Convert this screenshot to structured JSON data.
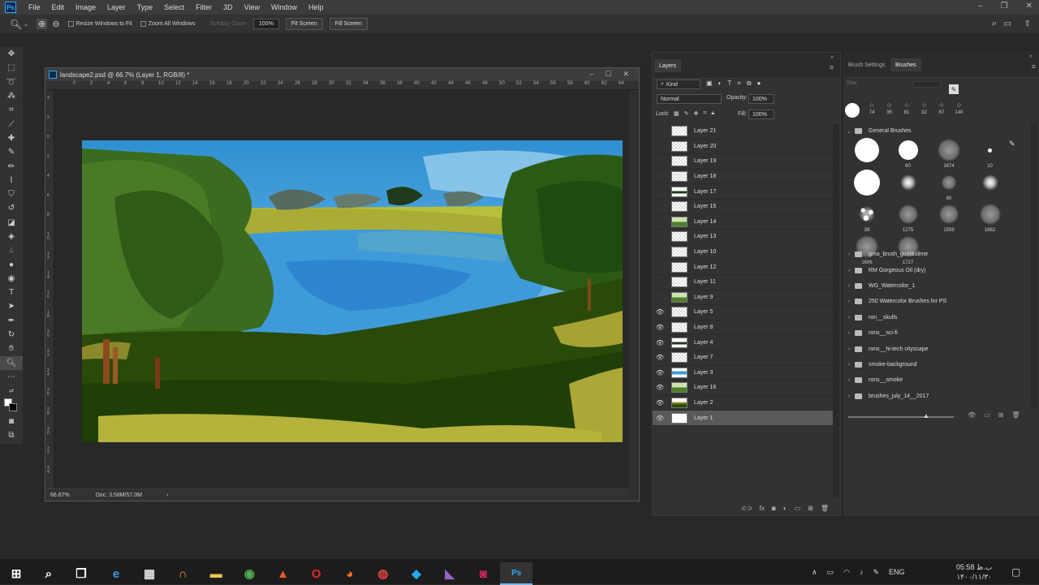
{
  "app": {
    "logo": "Ps",
    "menu": [
      "File",
      "Edit",
      "Image",
      "Layer",
      "Type",
      "Select",
      "Filter",
      "3D",
      "View",
      "Window",
      "Help"
    ]
  },
  "options": {
    "resize_windows": "Resize Windows to Fit",
    "zoom_all": "Zoom All Windows",
    "scrubby": "Scrubby Zoom",
    "zoom_value": "100%",
    "fit_screen": "Fit Screen",
    "fill_screen": "Fill Screen"
  },
  "document": {
    "title": "landscape2.psd @ 66.7% (Layer 1, RGB/8) *",
    "zoom": "66.67%",
    "doc_info": "Doc: 3.58M/57.0M",
    "hruler": [
      "0",
      "2",
      "4",
      "6",
      "8",
      "10",
      "12",
      "14",
      "16",
      "18",
      "20",
      "22",
      "24",
      "26",
      "28",
      "30",
      "32",
      "34",
      "36",
      "38",
      "40",
      "42",
      "44",
      "46",
      "48",
      "50",
      "52",
      "54",
      "56",
      "58",
      "60",
      "62",
      "64"
    ],
    "vruler": [
      "4",
      "2",
      "0",
      "2",
      "4",
      "6",
      "8",
      "1\n0",
      "1\n2",
      "1\n4",
      "1\n6",
      "1\n8",
      "2\n0",
      "2\n2",
      "2\n4",
      "2\n6",
      "2\n8",
      "3\n0",
      "3\n2",
      "3\n4"
    ]
  },
  "layers": {
    "tab": "Layers",
    "kind": "Kind",
    "blend": "Normal",
    "opacity_label": "Opacity:",
    "opacity": "100%",
    "lock_label": "Lock:",
    "fill_label": "Fill:",
    "fill": "100%",
    "items": [
      {
        "name": "Layer 21",
        "visible": false,
        "thumb": "empty"
      },
      {
        "name": "Layer 20",
        "visible": false,
        "thumb": "empty"
      },
      {
        "name": "Layer 19",
        "visible": false,
        "thumb": "empty"
      },
      {
        "name": "Layer 18",
        "visible": false,
        "thumb": "empty"
      },
      {
        "name": "Layer 17",
        "visible": false,
        "thumb": "dark"
      },
      {
        "name": "Layer 15",
        "visible": false,
        "thumb": "empty"
      },
      {
        "name": "Layer 14",
        "visible": false,
        "thumb": "green"
      },
      {
        "name": "Layer 13",
        "visible": false,
        "thumb": "empty"
      },
      {
        "name": "Layer 10",
        "visible": false,
        "thumb": "empty"
      },
      {
        "name": "Layer 12",
        "visible": false,
        "thumb": "empty"
      },
      {
        "name": "Layer 11",
        "visible": false,
        "thumb": "empty"
      },
      {
        "name": "Layer 9",
        "visible": false,
        "thumb": "green"
      },
      {
        "name": "Layer 5",
        "visible": true,
        "thumb": "empty"
      },
      {
        "name": "Layer 8",
        "visible": true,
        "thumb": "empty"
      },
      {
        "name": "Layer 4",
        "visible": true,
        "thumb": "dark"
      },
      {
        "name": "Layer 7",
        "visible": true,
        "thumb": "empty"
      },
      {
        "name": "Layer 3",
        "visible": true,
        "thumb": "blue"
      },
      {
        "name": "Layer 16",
        "visible": true,
        "thumb": "green"
      },
      {
        "name": "Layer 2",
        "visible": true,
        "thumb": "yellow"
      },
      {
        "name": "Layer 1",
        "visible": true,
        "thumb": "white",
        "selected": true
      }
    ]
  },
  "brushes": {
    "tabs": [
      "Brush Settings",
      "Brushes"
    ],
    "size_label": "Size:",
    "recent": [
      "74",
      "35",
      "81",
      "32",
      "67",
      "140"
    ],
    "general_group": "General Brushes",
    "grid": [
      {
        "num": "",
        "kind": "hard",
        "size": 30
      },
      {
        "num": "60",
        "kind": "hard",
        "size": 24
      },
      {
        "num": "1674",
        "kind": "texture",
        "size": 28
      },
      {
        "num": "10",
        "kind": "hard",
        "size": 5
      },
      {
        "num": "",
        "kind": "hard",
        "size": 32
      },
      {
        "num": "",
        "kind": "soft",
        "size": 20
      },
      {
        "num": "80",
        "kind": "texture",
        "size": 18
      },
      {
        "num": "",
        "kind": "soft",
        "size": 20
      },
      {
        "num": "38",
        "kind": "splatter",
        "size": 24
      },
      {
        "num": "1275",
        "kind": "texture",
        "size": 24
      },
      {
        "num": "1559",
        "kind": "texture",
        "size": 24
      },
      {
        "num": "1682",
        "kind": "texture",
        "size": 26
      },
      {
        "num": "1696",
        "kind": "texture",
        "size": 28
      },
      {
        "num": "1727",
        "kind": "texture",
        "size": 26
      }
    ],
    "sets": [
      "gma_brush_gust&slime",
      "RM Gorgeous Oil (dry)",
      "WG_Watercolor_1",
      "250 Watercolor Brushes for PS",
      "ron__skulls",
      "rons__sci-fi",
      "rons__hi-tech cityscape",
      "smoke-background",
      "rons__smoke",
      "brushes_july_14__2017"
    ]
  },
  "taskbar": {
    "icons": [
      "windows-start",
      "search",
      "task-view",
      "edge",
      "calculator",
      "headphones",
      "file-explorer",
      "chrome",
      "brave",
      "opera",
      "firefox",
      "gitkraken",
      "vscode",
      "visual-studio",
      "screen-recorder",
      "photoshop"
    ],
    "lang": "ENG",
    "time": "05:58 ب.ظ",
    "date": "۱۴۰۰/۱۱/۳۰"
  }
}
